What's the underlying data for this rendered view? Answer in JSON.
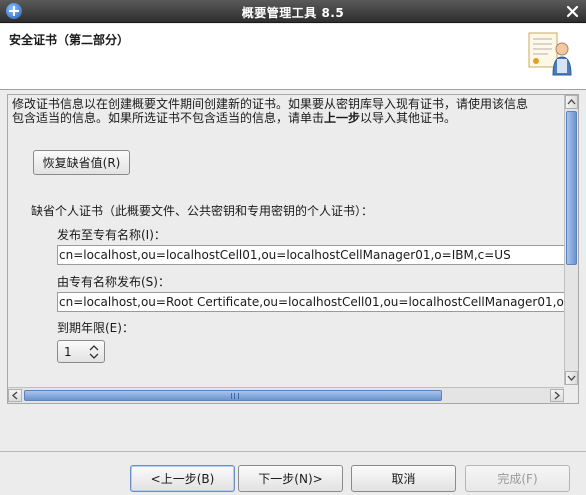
{
  "window": {
    "title": "概要管理工具 8.5"
  },
  "banner": {
    "page_title": "安全证书（第二部分）"
  },
  "content": {
    "description_line1": "修改证书信息以在创建概要文件期间创建新的证书。如果要从密钥库导入现有证书，请使用该信息",
    "description_line2_prefix": "包含适当的信息。如果所选证书不包含适当的信息，请单击",
    "description_line2_bold": "上一步",
    "description_line2_suffix": "以导入其他证书。",
    "restore_button": "恢复缺省值(R)",
    "group_label": "缺省个人证书（此概要文件、公共密钥和专用密钥的个人证书）：",
    "issued_to_label": "发布至专有名称(I)：",
    "issued_to_value": "cn=localhost,ou=localhostCell01,ou=localhostCellManager01,o=IBM,c=US",
    "issued_by_label": "由专有名称发布(S)：",
    "issued_by_value": "cn=localhost,ou=Root Certificate,ou=localhostCell01,ou=localhostCellManager01,o=IBM,c=US",
    "expiry_label": "到期年限(E)：",
    "expiry_value": "1"
  },
  "buttons": {
    "back": "<上一步(B)",
    "next": "下一步(N)>",
    "cancel": "取消",
    "finish": "完成(F)"
  }
}
